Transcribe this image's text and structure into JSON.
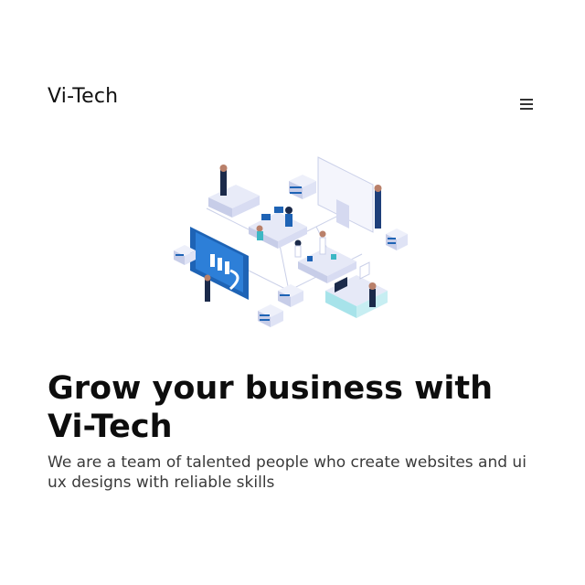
{
  "header": {
    "brand": "Vi-Tech",
    "menu_icon": "hamburger-menu-icon"
  },
  "hero": {
    "illustration_icon": "isometric-tech-office-illustration",
    "headline": "Grow your business with Vi-Tech",
    "subtext": "We are a team of talented people who create websites and ui ux designs with reliable skills"
  },
  "colors": {
    "text": "#111111",
    "subtext": "#3a3a3a",
    "accent_blue": "#1e63b5",
    "dark_navy": "#1b2a4a",
    "light_lavender": "#e6e9f7"
  }
}
